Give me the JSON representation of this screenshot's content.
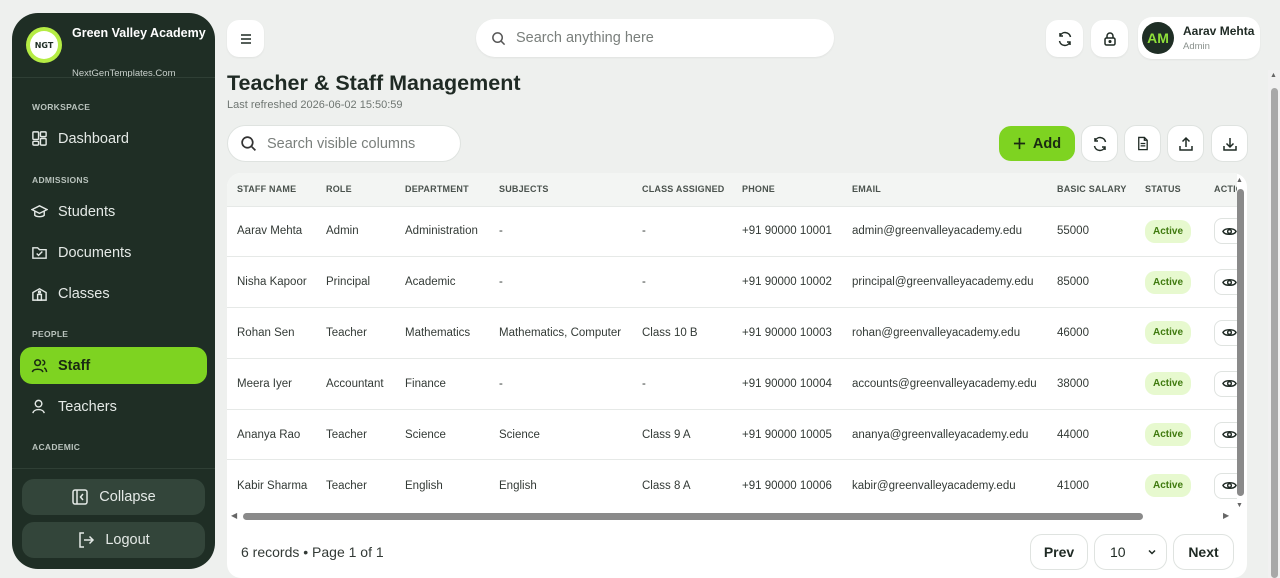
{
  "brand": {
    "name": "Green Valley Academy",
    "tagline": "NextGenTemplates.Com",
    "logo_text": "NGT"
  },
  "sidebar": {
    "sections": [
      {
        "label": "WORKSPACE"
      },
      {
        "label": "ADMISSIONS"
      },
      {
        "label": "PEOPLE"
      },
      {
        "label": "ACADEMIC"
      }
    ],
    "items": [
      {
        "label": "Dashboard",
        "icon": "dashboard-icon"
      },
      {
        "label": "Students",
        "icon": "graduation-cap-icon"
      },
      {
        "label": "Documents",
        "icon": "folder-check-icon"
      },
      {
        "label": "Classes",
        "icon": "school-building-icon"
      },
      {
        "label": "Staff",
        "icon": "users-icon",
        "active": true
      },
      {
        "label": "Teachers",
        "icon": "user-icon"
      }
    ],
    "collapse_label": "Collapse",
    "logout_label": "Logout"
  },
  "topbar": {
    "search_placeholder": "Search anything here",
    "user": {
      "initials": "AM",
      "name": "Aarav Mehta",
      "role": "Admin"
    }
  },
  "page": {
    "title": "Teacher & Staff Management",
    "last_refreshed": "Last refreshed 2026-06-02 15:50:59"
  },
  "toolbar": {
    "column_search_placeholder": "Search visible columns",
    "add_label": "Add"
  },
  "table": {
    "columns": [
      "STAFF NAME",
      "ROLE",
      "DEPARTMENT",
      "SUBJECTS",
      "CLASS ASSIGNED",
      "PHONE",
      "EMAIL",
      "BASIC SALARY",
      "STATUS",
      "ACTIONS"
    ],
    "rows": [
      [
        "Aarav Mehta",
        "Admin",
        "Administration",
        "-",
        "-",
        "+91 90000 10001",
        "admin@greenvalleyacademy.edu",
        "55000",
        "Active"
      ],
      [
        "Nisha Kapoor",
        "Principal",
        "Academic",
        "-",
        "-",
        "+91 90000 10002",
        "principal@greenvalleyacademy.edu",
        "85000",
        "Active"
      ],
      [
        "Rohan Sen",
        "Teacher",
        "Mathematics",
        "Mathematics, Computer",
        "Class 10 B",
        "+91 90000 10003",
        "rohan@greenvalleyacademy.edu",
        "46000",
        "Active"
      ],
      [
        "Meera Iyer",
        "Accountant",
        "Finance",
        "-",
        "-",
        "+91 90000 10004",
        "accounts@greenvalleyacademy.edu",
        "38000",
        "Active"
      ],
      [
        "Ananya Rao",
        "Teacher",
        "Science",
        "Science",
        "Class 9 A",
        "+91 90000 10005",
        "ananya@greenvalleyacademy.edu",
        "44000",
        "Active"
      ],
      [
        "Kabir Sharma",
        "Teacher",
        "English",
        "English",
        "Class 8 A",
        "+91 90000 10006",
        "kabir@greenvalleyacademy.edu",
        "41000",
        "Active"
      ]
    ]
  },
  "pagination": {
    "summary": "6 records • Page 1 of 1",
    "prev_label": "Prev",
    "next_label": "Next",
    "page_size": "10"
  },
  "colors": {
    "accent": "#7ed321",
    "sidebar_bg": "#1f2e25",
    "badge_bg": "#e7f9cf",
    "badge_text": "#3f7a0e"
  }
}
